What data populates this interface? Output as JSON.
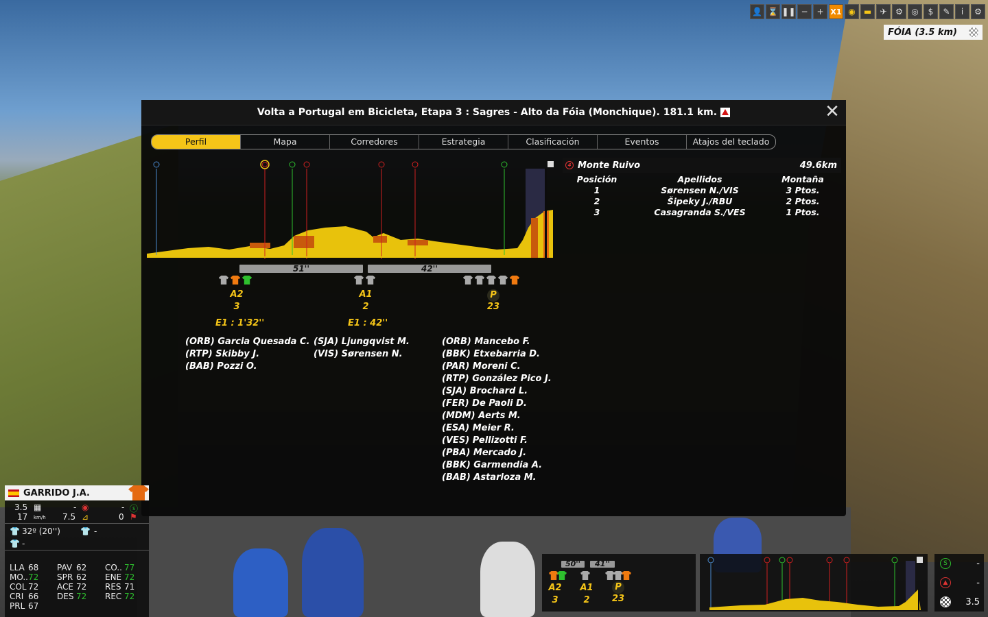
{
  "toolbar": {
    "speed_label": "X1",
    "location": "FÓIA (3.5 km)"
  },
  "modal": {
    "title": "Volta a Portugal em Bicicleta, Etapa 3 : Sagres - Alto da Fóia (Monchique). 181.1 km.",
    "tabs": [
      "Perfil",
      "Mapa",
      "Corredores",
      "Estrategia",
      "Clasificación",
      "Eventos",
      "Atajos del teclado"
    ],
    "active_tab": "Perfil",
    "gaps": [
      "51''",
      "42''"
    ],
    "groups": [
      {
        "label": "A2",
        "count": "3",
        "time": "E1 : 1'32''",
        "riders": [
          "(ORB) Garcia Quesada C.",
          "(RTP) Skibby J.",
          "(BAB) Pozzi O."
        ]
      },
      {
        "label": "A1",
        "count": "2",
        "time": "E1 : 42''",
        "riders": [
          "(SJA) Ljungqvist M.",
          "(VIS) Sørensen N."
        ]
      },
      {
        "label": "P",
        "count": "23",
        "time": "",
        "riders": [
          "(ORB) Mancebo F.",
          "(BBK) Etxebarria D.",
          "(PAR) Moreni C.",
          "(RTP) González Pico J.",
          "(SJA) Brochard L.",
          "(FER) De Paoli D.",
          "(MDM) Aerts M.",
          "(ESA) Meier R.",
          "(VES) Pellizotti F.",
          "(PBA) Mercado J.",
          "(BBK) Garmendia A.",
          "(BAB) Astarloza M."
        ]
      }
    ],
    "classification": {
      "climb_cat": "4",
      "climb_name": "Monte Ruivo",
      "climb_km": "49.6km",
      "headers": [
        "Posición",
        "Apellidos",
        "Montaña"
      ],
      "rows": [
        [
          "1",
          "Sørensen N./VIS",
          "3 Ptos."
        ],
        [
          "2",
          "Šipeky J./RBU",
          "2 Ptos."
        ],
        [
          "3",
          "Casagranda S./VES",
          "1 Ptos."
        ]
      ]
    }
  },
  "rider": {
    "name": "GARRIDO J.A.",
    "dist": "3.5",
    "speed": "17",
    "speed_unit": "km/h",
    "grade": "7.5",
    "mountain": "-",
    "sprint": "-",
    "flag_val": "0",
    "gc": "32º (20'')",
    "points": "-",
    "polka": "-",
    "stats": [
      [
        "LLA",
        "68"
      ],
      [
        "PAV",
        "62"
      ],
      [
        "CO..",
        "77"
      ],
      [
        "MO..",
        "72"
      ],
      [
        "SPR",
        "62"
      ],
      [
        "ENE",
        "72"
      ],
      [
        "COL",
        "72"
      ],
      [
        "ACE",
        "72"
      ],
      [
        "RES",
        "71"
      ],
      [
        "CRI",
        "66"
      ],
      [
        "DES",
        "72"
      ],
      [
        "REC",
        "72"
      ],
      [
        "PRL",
        "67"
      ]
    ]
  },
  "mini": {
    "gaps": [
      "50''",
      "41''"
    ],
    "groups": [
      {
        "label": "A2",
        "count": "3"
      },
      {
        "label": "A1",
        "count": "2"
      },
      {
        "label": "P",
        "count": "23"
      }
    ],
    "stats": [
      {
        "icon": "sprint-icon",
        "value": "-"
      },
      {
        "icon": "mountain-icon",
        "value": "-"
      },
      {
        "icon": "finish-flag-icon",
        "value": "3.5"
      }
    ]
  }
}
